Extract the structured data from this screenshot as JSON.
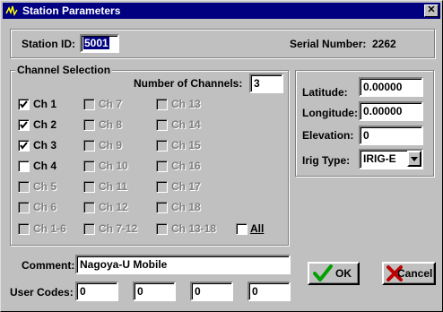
{
  "window": {
    "title": "Station Parameters",
    "close_label": "✕"
  },
  "station": {
    "id_label": "Station ID:",
    "id_value": "5001",
    "serial_label": "Serial Number:",
    "serial_value": "2262"
  },
  "channel_selection": {
    "title": "Channel Selection",
    "num_channels_label": "Number of Channels:",
    "num_channels_value": "3",
    "channels": [
      {
        "label": "Ch 1",
        "checked": true,
        "enabled": true
      },
      {
        "label": "Ch 2",
        "checked": true,
        "enabled": true
      },
      {
        "label": "Ch 3",
        "checked": true,
        "enabled": true
      },
      {
        "label": "Ch 4",
        "checked": false,
        "enabled": true
      },
      {
        "label": "Ch 5",
        "checked": false,
        "enabled": false
      },
      {
        "label": "Ch 6",
        "checked": false,
        "enabled": false
      },
      {
        "label": "Ch 1-6",
        "checked": false,
        "enabled": false
      },
      {
        "label": "Ch 7",
        "checked": false,
        "enabled": false
      },
      {
        "label": "Ch 8",
        "checked": false,
        "enabled": false
      },
      {
        "label": "Ch 9",
        "checked": false,
        "enabled": false
      },
      {
        "label": "Ch 10",
        "checked": false,
        "enabled": false
      },
      {
        "label": "Ch 11",
        "checked": false,
        "enabled": false
      },
      {
        "label": "Ch 12",
        "checked": false,
        "enabled": false
      },
      {
        "label": "Ch 7-12",
        "checked": false,
        "enabled": false
      },
      {
        "label": "Ch 13",
        "checked": false,
        "enabled": false
      },
      {
        "label": "Ch 14",
        "checked": false,
        "enabled": false
      },
      {
        "label": "Ch 15",
        "checked": false,
        "enabled": false
      },
      {
        "label": "Ch 16",
        "checked": false,
        "enabled": false
      },
      {
        "label": "Ch 17",
        "checked": false,
        "enabled": false
      },
      {
        "label": "Ch 18",
        "checked": false,
        "enabled": false
      },
      {
        "label": "Ch 13-18",
        "checked": false,
        "enabled": false
      }
    ],
    "all_label": "All",
    "all_checked": false
  },
  "location": {
    "latitude_label": "Latitude:",
    "latitude_value": "0.00000",
    "longitude_label": "Longitude:",
    "longitude_value": "0.00000",
    "elevation_label": "Elevation:",
    "elevation_value": "0",
    "irig_label": "Irig Type:",
    "irig_value": "IRIG-E"
  },
  "comment": {
    "label": "Comment:",
    "value": "Nagoya-U Mobile"
  },
  "user_codes": {
    "label": "User Codes:",
    "values": [
      "0",
      "0",
      "0",
      "0"
    ]
  },
  "buttons": {
    "ok_label": "OK",
    "cancel_label": "Cancel"
  },
  "colors": {
    "title_bar": "#000080",
    "face": "#c0c0c0",
    "ok_check": "#00a000",
    "cancel_x": "#c00000"
  }
}
